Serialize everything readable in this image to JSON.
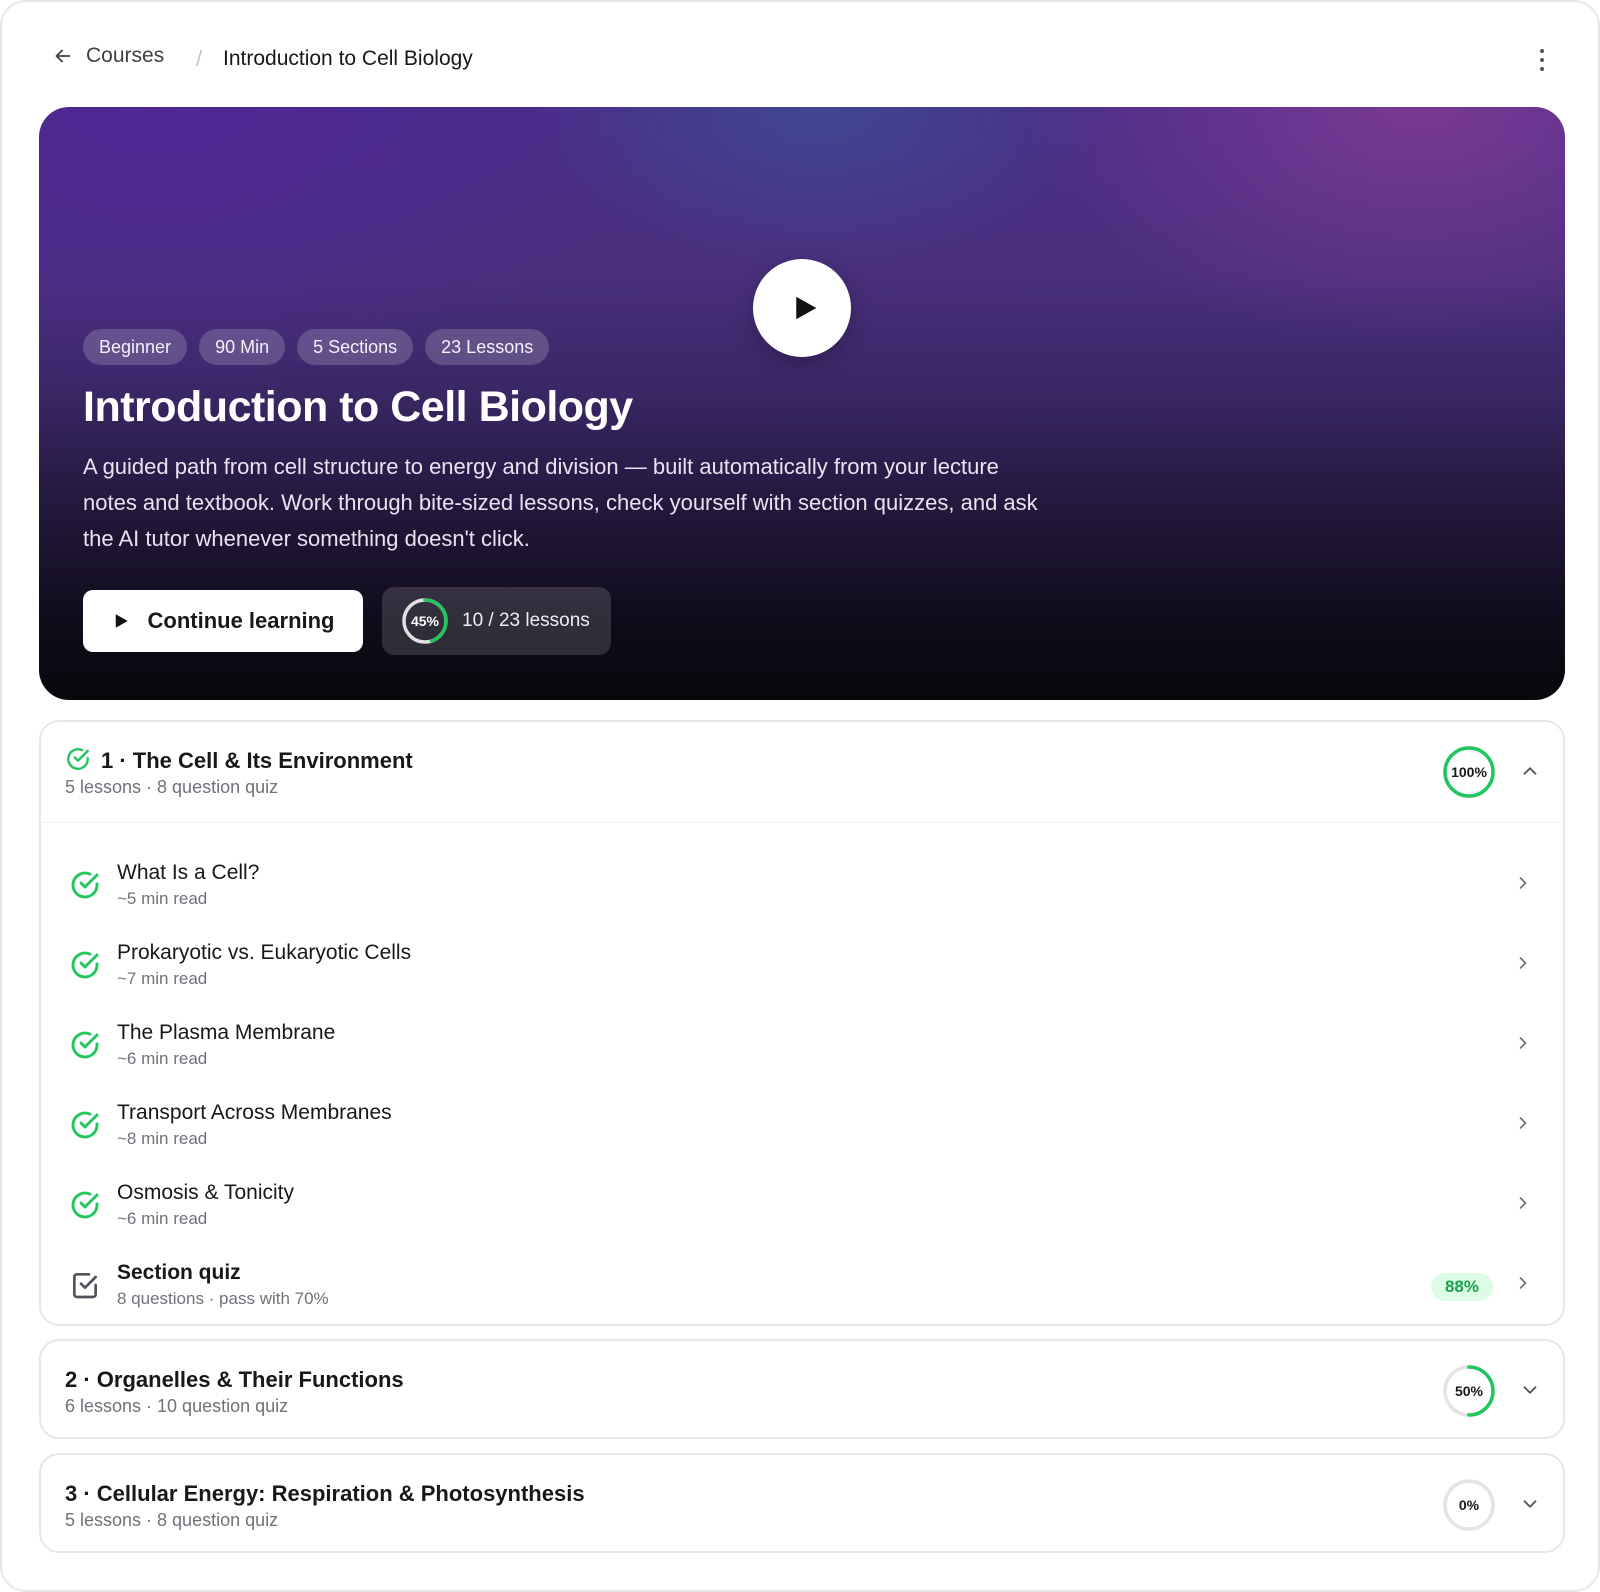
{
  "breadcrumb": {
    "back_label": "Courses",
    "separator": "/",
    "current": "Introduction to Cell Biology"
  },
  "hero": {
    "tags": [
      "Beginner",
      "90 Min",
      "5 Sections",
      "23 Lessons"
    ],
    "title": "Introduction to Cell Biology",
    "description": "A guided path from cell structure to energy and division — built automatically from your lecture notes and textbook. Work through bite-sized lessons, check yourself with section quizzes, and ask the AI tutor whenever something doesn't click.",
    "continue_label": "Continue learning",
    "progress": {
      "percent_label": "45%",
      "fraction": 0.45,
      "lessons_text": "10 / 23 lessons"
    }
  },
  "sections": [
    {
      "title": "1 · The Cell & Its Environment",
      "meta": "5 lessons · 8 question quiz",
      "progress_label": "100%",
      "progress": 1.0,
      "completed": true,
      "expanded": true,
      "lessons": [
        {
          "title": "What Is a Cell?",
          "meta": "~5 min read"
        },
        {
          "title": "Prokaryotic vs. Eukaryotic Cells",
          "meta": "~7 min read"
        },
        {
          "title": "The Plasma Membrane",
          "meta": "~6 min read"
        },
        {
          "title": "Transport Across Membranes",
          "meta": "~8 min read"
        },
        {
          "title": "Osmosis & Tonicity",
          "meta": "~6 min read"
        }
      ],
      "quiz": {
        "title": "Section quiz",
        "meta": "8 questions · pass with 70%",
        "score": "88%"
      }
    },
    {
      "title": "2 · Organelles & Their Functions",
      "meta": "6 lessons · 10 question quiz",
      "progress_label": "50%",
      "progress": 0.5,
      "completed": false,
      "expanded": false
    },
    {
      "title": "3 · Cellular Energy: Respiration & Photosynthesis",
      "meta": "5 lessons · 8 question quiz",
      "progress_label": "0%",
      "progress": 0.0,
      "completed": false,
      "expanded": false
    }
  ],
  "colors": {
    "accent_green": "#22c55e",
    "ring_track": "#e4e4e7",
    "text_primary": "#18181b",
    "text_muted": "#71717a"
  }
}
